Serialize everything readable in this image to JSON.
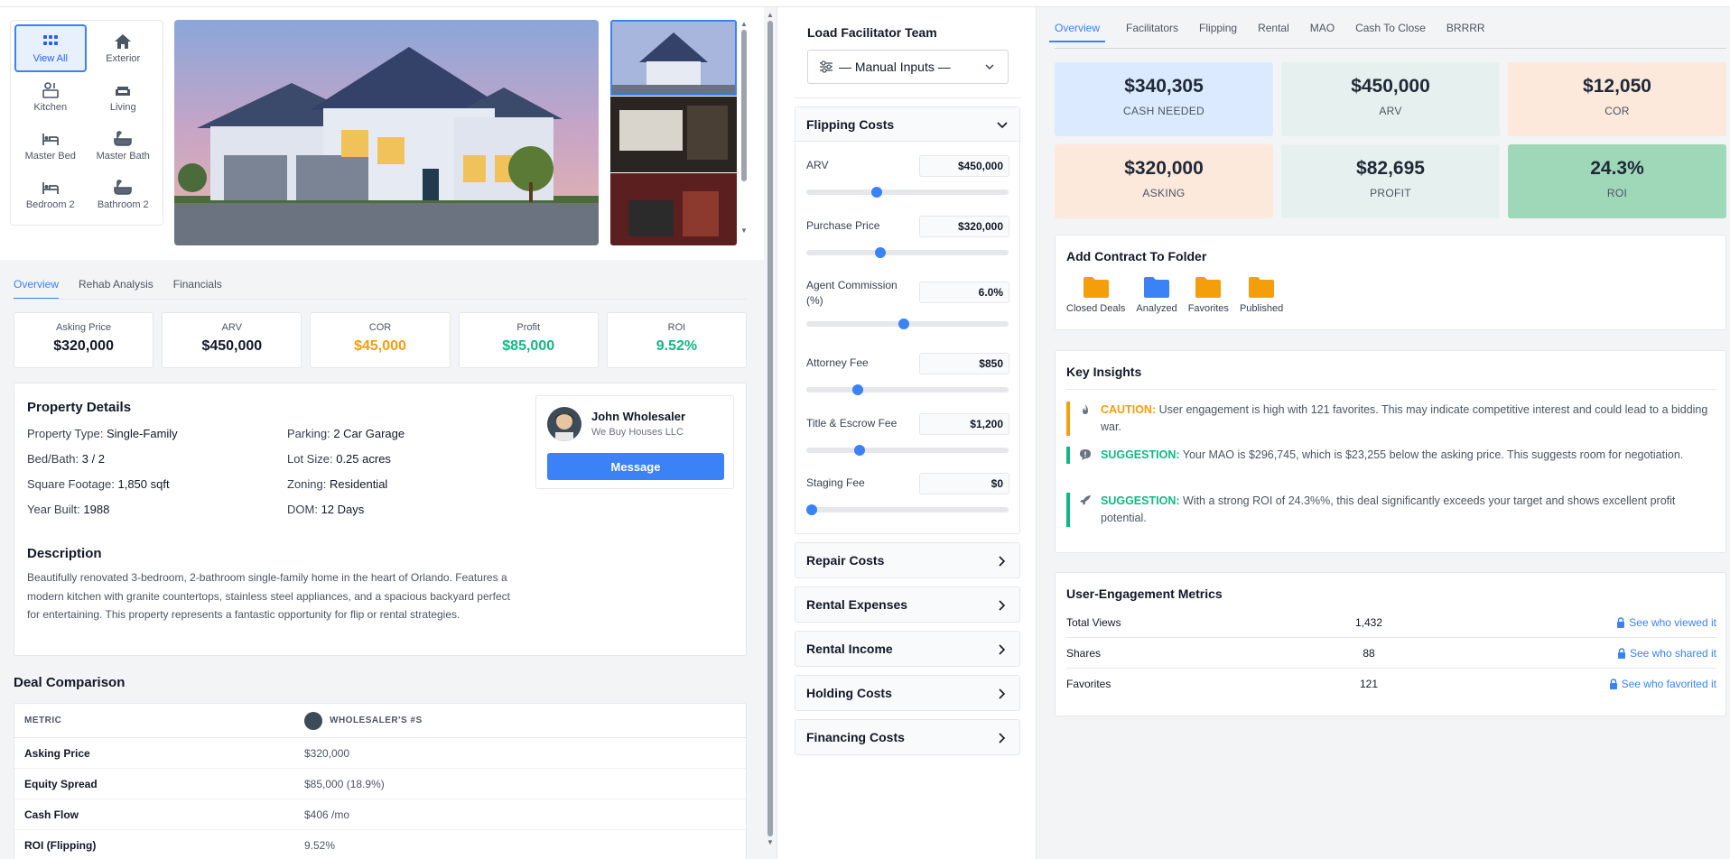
{
  "gallery": {
    "categories": [
      {
        "label": "View All",
        "icon": "grid-icon"
      },
      {
        "label": "Exterior",
        "icon": "house-icon"
      },
      {
        "label": "Kitchen",
        "icon": "kitchen-icon"
      },
      {
        "label": "Living",
        "icon": "sofa-icon"
      },
      {
        "label": "Master Bed",
        "icon": "bed-icon"
      },
      {
        "label": "Master Bath",
        "icon": "bathtub-icon"
      },
      {
        "label": "Bedroom 2",
        "icon": "bed-icon"
      },
      {
        "label": "Bathroom 2",
        "icon": "bathtub-icon"
      }
    ]
  },
  "left_tabs": [
    "Overview",
    "Rehab Analysis",
    "Financials"
  ],
  "summary": [
    {
      "label": "Asking Price",
      "value": "$320,000"
    },
    {
      "label": "ARV",
      "value": "$450,000"
    },
    {
      "label": "COR",
      "value": "$45,000"
    },
    {
      "label": "Profit",
      "value": "$85,000"
    },
    {
      "label": "ROI",
      "value": "9.52%"
    }
  ],
  "property": {
    "title": "Property Details",
    "left": [
      {
        "k": "Property Type:",
        "v": "Single-Family"
      },
      {
        "k": "Bed/Bath:",
        "v": "3 / 2"
      },
      {
        "k": "Square Footage:",
        "v": "1,850 sqft"
      },
      {
        "k": "Year Built:",
        "v": "1988"
      }
    ],
    "right": [
      {
        "k": "Parking:",
        "v": "2 Car Garage"
      },
      {
        "k": "Lot Size:",
        "v": "0.25 acres"
      },
      {
        "k": "Zoning:",
        "v": "Residential"
      },
      {
        "k": "DOM:",
        "v": "12 Days"
      }
    ],
    "desc_title": "Description",
    "description": "Beautifully renovated 3-bedroom, 2-bathroom single-family home in the heart of Orlando. Features a modern kitchen with granite countertops, stainless steel appliances, and a spacious backyard perfect for entertaining. This property represents a fantastic opportunity for flip or rental strategies."
  },
  "agent": {
    "name": "John Wholesaler",
    "company": "We Buy Houses LLC",
    "button": "Message"
  },
  "deal": {
    "title": "Deal Comparison",
    "col1": "METRIC",
    "col2": "WHOLESALER'S #S",
    "rows": [
      {
        "m": "Asking Price",
        "v": "$320,000"
      },
      {
        "m": "Equity Spread",
        "v": "$85,000 (18.9%)"
      },
      {
        "m": "Cash Flow",
        "v": "$406 /mo"
      },
      {
        "m": "ROI (Flipping)",
        "v": "9.52%"
      }
    ]
  },
  "mid": {
    "team_label": "Load Facilitator Team",
    "team_value": "— Manual Inputs —",
    "open_section": "Flipping Costs",
    "fields": [
      {
        "label": "ARV",
        "value": "$450,000",
        "pct": 0.34
      },
      {
        "label": "Purchase Price",
        "value": "$320,000",
        "pct": 0.36
      },
      {
        "label": "Agent Commission (%)",
        "value": "6.0%",
        "pct": 0.48
      },
      {
        "label": "Attorney Fee",
        "value": "$850",
        "pct": 0.24
      },
      {
        "label": "Title & Escrow Fee",
        "value": "$1,200",
        "pct": 0.25
      },
      {
        "label": "Staging Fee",
        "value": "$0",
        "pct": 0.0
      }
    ],
    "sections": [
      "Repair Costs",
      "Rental Expenses",
      "Rental Income",
      "Holding Costs",
      "Financing Costs"
    ]
  },
  "right_tabs": [
    "Overview",
    "Facilitators",
    "Flipping",
    "Rental",
    "MAO",
    "Cash To Close",
    "BRRRR"
  ],
  "kpis": [
    {
      "value": "$340,305",
      "label": "CASH NEEDED",
      "bg": "#dbeafe"
    },
    {
      "value": "$450,000",
      "label": "ARV",
      "bg": "#e6f1ef"
    },
    {
      "value": "$12,050",
      "label": "COR",
      "bg": "#fde8dc"
    },
    {
      "value": "$320,000",
      "label": "ASKING",
      "bg": "#fde8dc"
    },
    {
      "value": "$82,695",
      "label": "PROFIT",
      "bg": "#e6f1ef"
    },
    {
      "value": "24.3%",
      "label": "ROI",
      "bg": "#9fd8b9"
    }
  ],
  "folders": {
    "title": "Add Contract To Folder",
    "items": [
      {
        "label": "Closed Deals",
        "color": "#f59e0b"
      },
      {
        "label": "Analyzed",
        "color": "#3b82f6"
      },
      {
        "label": "Favorites",
        "color": "#f59e0b"
      },
      {
        "label": "Published",
        "color": "#f59e0b"
      }
    ]
  },
  "insights": {
    "title": "Key Insights",
    "items": [
      {
        "tag": "CAUTION:",
        "text": " User engagement is high with 121 favorites. This may indicate competitive interest and could lead to a bidding war.",
        "color": "#f59e0b",
        "icon": "fire-icon"
      },
      {
        "tag": "SUGGESTION:",
        "text": " Your MAO is $296,745, which is $23,255 below the asking price. This suggests room for negotiation.",
        "color": "#10b981",
        "icon": "chat-icon"
      },
      {
        "tag": "SUGGESTION:",
        "text": " With a strong ROI of 24.3%%, this deal significantly exceeds your target and shows excellent profit potential.",
        "color": "#10b981",
        "icon": "rocket-icon"
      }
    ]
  },
  "engagement": {
    "title": "User-Engagement Metrics",
    "rows": [
      {
        "name": "Total Views",
        "count": "1,432",
        "link": "See who viewed it"
      },
      {
        "name": "Shares",
        "count": "88",
        "link": "See who shared it"
      },
      {
        "name": "Favorites",
        "count": "121",
        "link": "See who favorited it"
      }
    ]
  }
}
